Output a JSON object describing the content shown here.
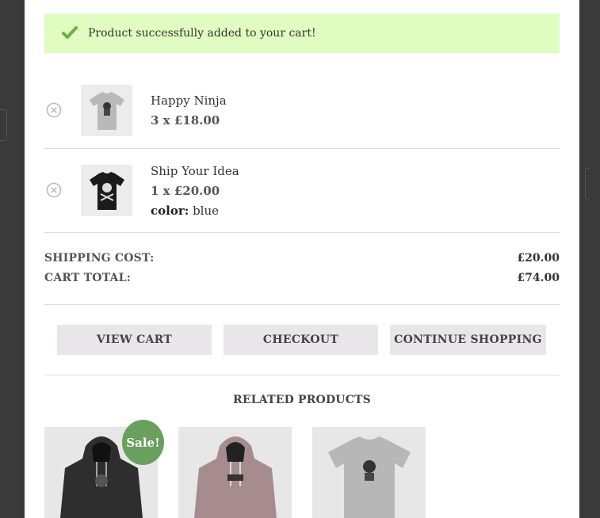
{
  "notice": {
    "message": "Product successfully added to your cart!",
    "icon": "check-icon",
    "color": "#e1fcc0"
  },
  "cart": {
    "items": [
      {
        "name": "Happy Ninja",
        "qty_price": "3 x £18.00",
        "image": "grey-tshirt"
      },
      {
        "name": "Ship Your Idea",
        "qty_price": "1 x £20.00",
        "attr_label": "color:",
        "attr_value": "blue",
        "image": "black-tshirt"
      }
    ],
    "shipping_label": "SHIPPING COST:",
    "shipping_value": "£20.00",
    "total_label": "CART TOTAL:",
    "total_value": "£74.00"
  },
  "buttons": {
    "view_cart": "VIEW CART",
    "checkout": "CHECKOUT",
    "continue": "CONTINUE SHOPPING"
  },
  "related": {
    "title": "RELATED PRODUCTS",
    "sale_badge": "Sale!",
    "sale_color": "#6a9f60",
    "products": [
      {
        "image": "black-hoodie"
      },
      {
        "image": "pink-hoodie"
      },
      {
        "image": "grey-tshirt"
      }
    ]
  }
}
